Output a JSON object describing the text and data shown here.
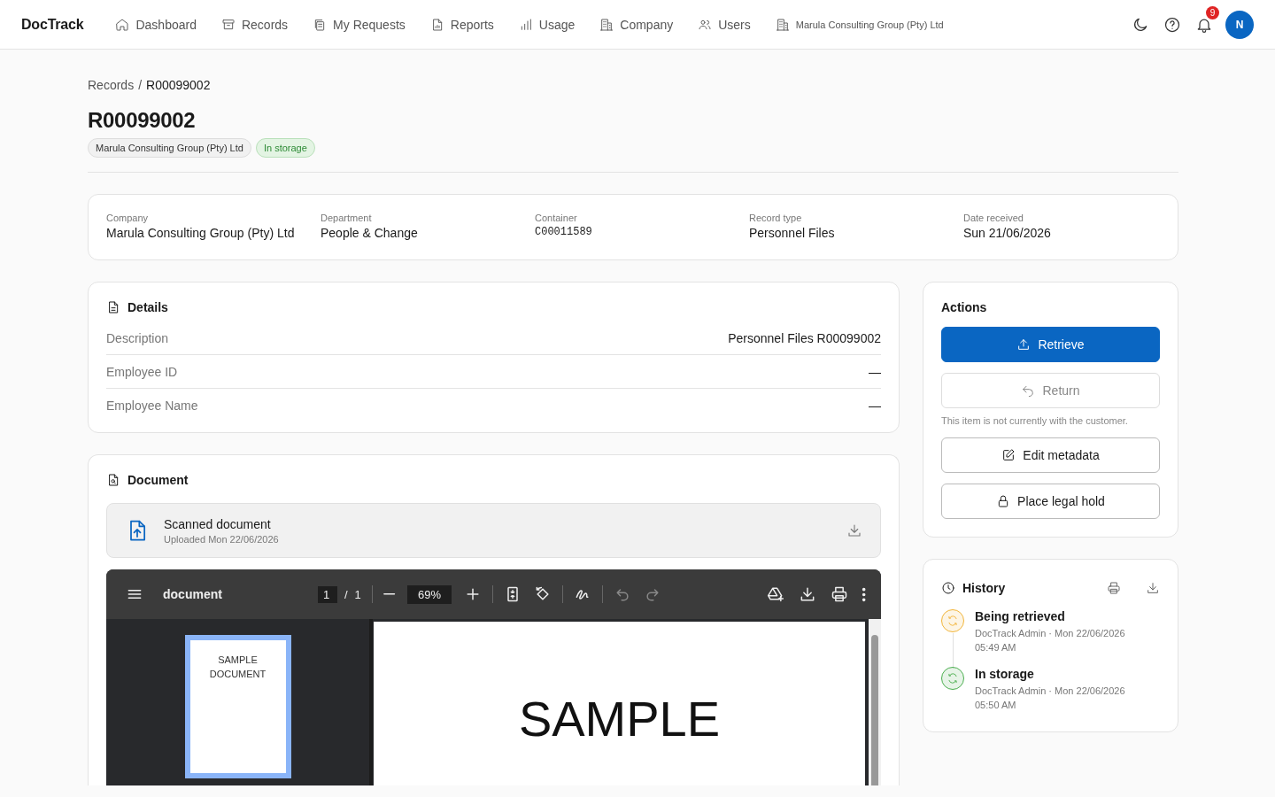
{
  "nav": {
    "brand": "DocTrack",
    "items": [
      {
        "label": "Dashboard"
      },
      {
        "label": "Records"
      },
      {
        "label": "My Requests"
      },
      {
        "label": "Reports"
      },
      {
        "label": "Usage"
      },
      {
        "label": "Company"
      },
      {
        "label": "Users"
      }
    ],
    "company": "Marula Consulting Group (Pty) Ltd",
    "notifications": "9",
    "avatar": "N"
  },
  "breadcrumb": {
    "items": [
      "Records",
      "R00099002"
    ],
    "separator": "/"
  },
  "title": "R00099002",
  "tags": [
    {
      "label": "Marula Consulting Group (Pty) Ltd",
      "kind": "neutral"
    },
    {
      "label": "In storage",
      "kind": "success"
    }
  ],
  "summary": [
    {
      "label": "Company",
      "value": "Marula Consulting Group (Pty) Ltd",
      "kind": "text"
    },
    {
      "label": "Department",
      "value": "People & Change",
      "kind": "text"
    },
    {
      "label": "Container",
      "value": "C00011589",
      "kind": "code"
    },
    {
      "label": "Record type",
      "value": "Personnel Files",
      "kind": "text"
    },
    {
      "label": "Date received",
      "value": "Sun 21/06/2026",
      "kind": "text"
    }
  ],
  "details": {
    "title": "Details",
    "rows": [
      {
        "label": "Description",
        "value": "Personnel Files R00099002"
      },
      {
        "label": "Employee ID",
        "value": "—"
      },
      {
        "label": "Employee Name",
        "value": "—"
      }
    ]
  },
  "document": {
    "title": "Document",
    "file": {
      "name": "Scanned document",
      "uploaded": "Uploaded Mon 22/06/2026"
    },
    "viewer": {
      "title": "document",
      "page": "1",
      "page_separator": "/",
      "pages": "1",
      "zoom": "69%",
      "thumbnail_lines": [
        "SAMPLE",
        "DOCUMENT"
      ],
      "page_lines": [
        "SAMPLE"
      ]
    }
  },
  "actions": {
    "title": "Actions",
    "buttons": [
      {
        "label": "Retrieve",
        "kind": "primary",
        "disabled": false
      },
      {
        "label": "Return",
        "kind": "outline",
        "disabled": true,
        "note": "This item is not currently with the customer."
      },
      {
        "label": "Edit metadata",
        "kind": "outline",
        "disabled": false
      },
      {
        "label": "Place legal hold",
        "kind": "outline",
        "disabled": false
      }
    ]
  },
  "history": {
    "title": "History",
    "events": [
      {
        "status": "Being retrieved",
        "meta": "DocTrack Admin · Mon 22/06/2026",
        "time": "05:49 AM",
        "color": "#f2b53a"
      },
      {
        "status": "In storage",
        "meta": "DocTrack Admin · Mon 22/06/2026",
        "time": "05:50 AM",
        "color": "#4caf50"
      }
    ]
  }
}
